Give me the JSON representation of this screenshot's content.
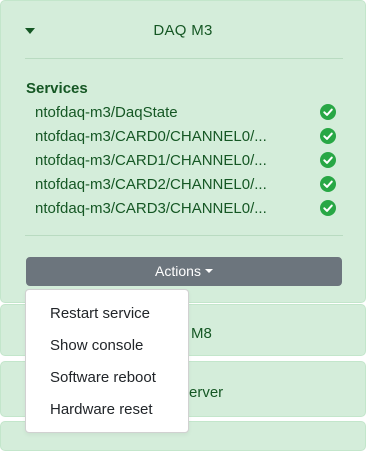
{
  "colors": {
    "card_bg": "#d4edda",
    "card_border": "#c3e6cb",
    "text": "#155724",
    "ok_icon": "#28a745",
    "button_bg": "#6c757d"
  },
  "card": {
    "title": "DAQ M3",
    "collapse_icon": "caret-down-icon",
    "services_heading": "Services",
    "services": [
      {
        "name": "ntofdaq-m3/DaqState",
        "status": "ok",
        "icon": "check-circle-icon"
      },
      {
        "name": "ntofdaq-m3/CARD0/CHANNEL0/...",
        "status": "ok",
        "icon": "check-circle-icon"
      },
      {
        "name": "ntofdaq-m3/CARD1/CHANNEL0/...",
        "status": "ok",
        "icon": "check-circle-icon"
      },
      {
        "name": "ntofdaq-m3/CARD2/CHANNEL0/...",
        "status": "ok",
        "icon": "check-circle-icon"
      },
      {
        "name": "ntofdaq-m3/CARD3/CHANNEL0/...",
        "status": "ok",
        "icon": "check-circle-icon"
      }
    ],
    "actions_label": "Actions"
  },
  "actions_menu": {
    "items": [
      "Restart service",
      "Show console",
      "Software reboot",
      "Hardware reset"
    ]
  },
  "background_cards": [
    {
      "visible_title": "M8"
    },
    {
      "visible_title": "erver"
    }
  ]
}
